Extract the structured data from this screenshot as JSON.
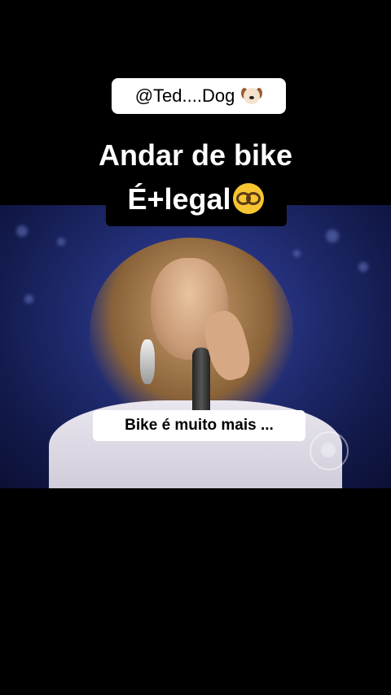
{
  "handle": {
    "text": "@Ted....Dog",
    "icon": "dog-face-icon"
  },
  "title": {
    "line1": "Andar de bike",
    "line2": "É+legal",
    "icon": "nerd-face-icon"
  },
  "caption": {
    "text": "Bike é muito mais ..."
  },
  "video": {
    "watermark_icon": "cbs-eye-logo"
  },
  "colors": {
    "background": "#000000",
    "badge_bg": "#ffffff",
    "stage_blue": "#24307a"
  }
}
